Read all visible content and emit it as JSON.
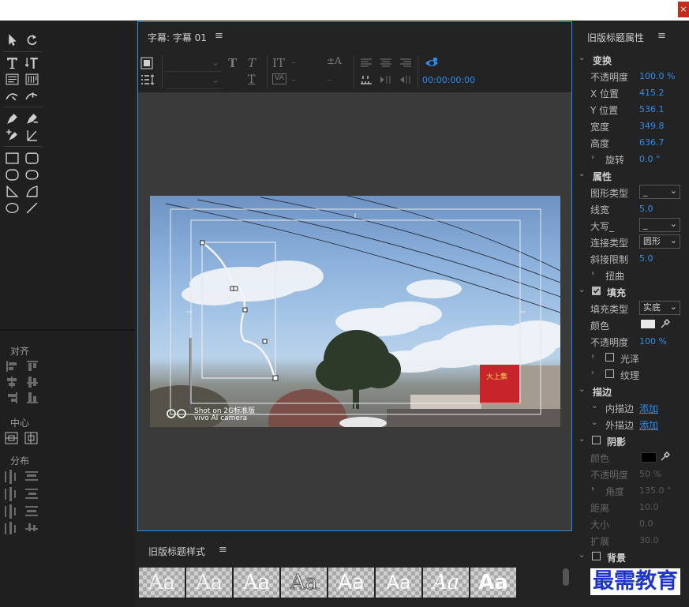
{
  "window": {
    "close_label": "×"
  },
  "tools": {
    "align_label": "对齐",
    "center_label": "中心",
    "distribute_label": "分布"
  },
  "title_panel": {
    "title": "字幕: 字幕 01",
    "timecode": "00:00:00:00"
  },
  "video": {
    "watermark_line1": "Shot on 2G标准版",
    "watermark_line2": "vivo AI camera",
    "sign_text": "大上集"
  },
  "styles_panel": {
    "title": "旧版标题样式",
    "swatches": [
      "Aa",
      "Aa",
      "Aa",
      "Aa",
      "Aa",
      "Aa",
      "Aa",
      "Aa"
    ]
  },
  "props": {
    "title": "旧版标题属性",
    "transform": {
      "header": "变换",
      "opacity_label": "不透明度",
      "opacity_value": "100.0 %",
      "x_label": "X 位置",
      "x_value": "415.2",
      "y_label": "Y 位置",
      "y_value": "536.1",
      "width_label": "宽度",
      "width_value": "349.8",
      "height_label": "高度",
      "height_value": "636.7",
      "rotation_label": "旋转",
      "rotation_value": "0.0 °"
    },
    "properties": {
      "header": "属性",
      "shape_type_label": "图形类型",
      "shape_type_value": "_",
      "line_width_label": "线宽",
      "line_width_value": "5.0",
      "caps_label": "大写_",
      "caps_value": "_",
      "join_type_label": "连接类型",
      "join_type_value": "圆形",
      "miter_label": "斜接限制",
      "miter_value": "5.0",
      "distort_label": "扭曲"
    },
    "fill": {
      "header": "填充",
      "fill_type_label": "填充类型",
      "fill_type_value": "实底",
      "color_label": "颜色",
      "color_value": "#e8e8e8",
      "opacity_label": "不透明度",
      "opacity_value": "100 %",
      "sheen_label": "光泽",
      "texture_label": "纹理"
    },
    "stroke": {
      "header": "描边",
      "inner_label": "内描边",
      "inner_action": "添加",
      "outer_label": "外描边",
      "outer_action": "添加"
    },
    "shadow": {
      "header": "阴影",
      "color_label": "颜色",
      "color_value": "#000000",
      "opacity_label": "不透明度",
      "opacity_value": "50 %",
      "angle_label": "角度",
      "angle_value": "135.0 °",
      "distance_label": "距离",
      "distance_value": "10.0",
      "size_label": "大小",
      "size_value": "0.0",
      "spread_label": "扩展",
      "spread_value": "30.0"
    },
    "background": {
      "header": "背景"
    }
  },
  "watermark": {
    "text": "最需教育"
  },
  "colors": {
    "accent": "#2d8ceb",
    "panel": "#232323",
    "canvas": "#3a3a3a"
  }
}
